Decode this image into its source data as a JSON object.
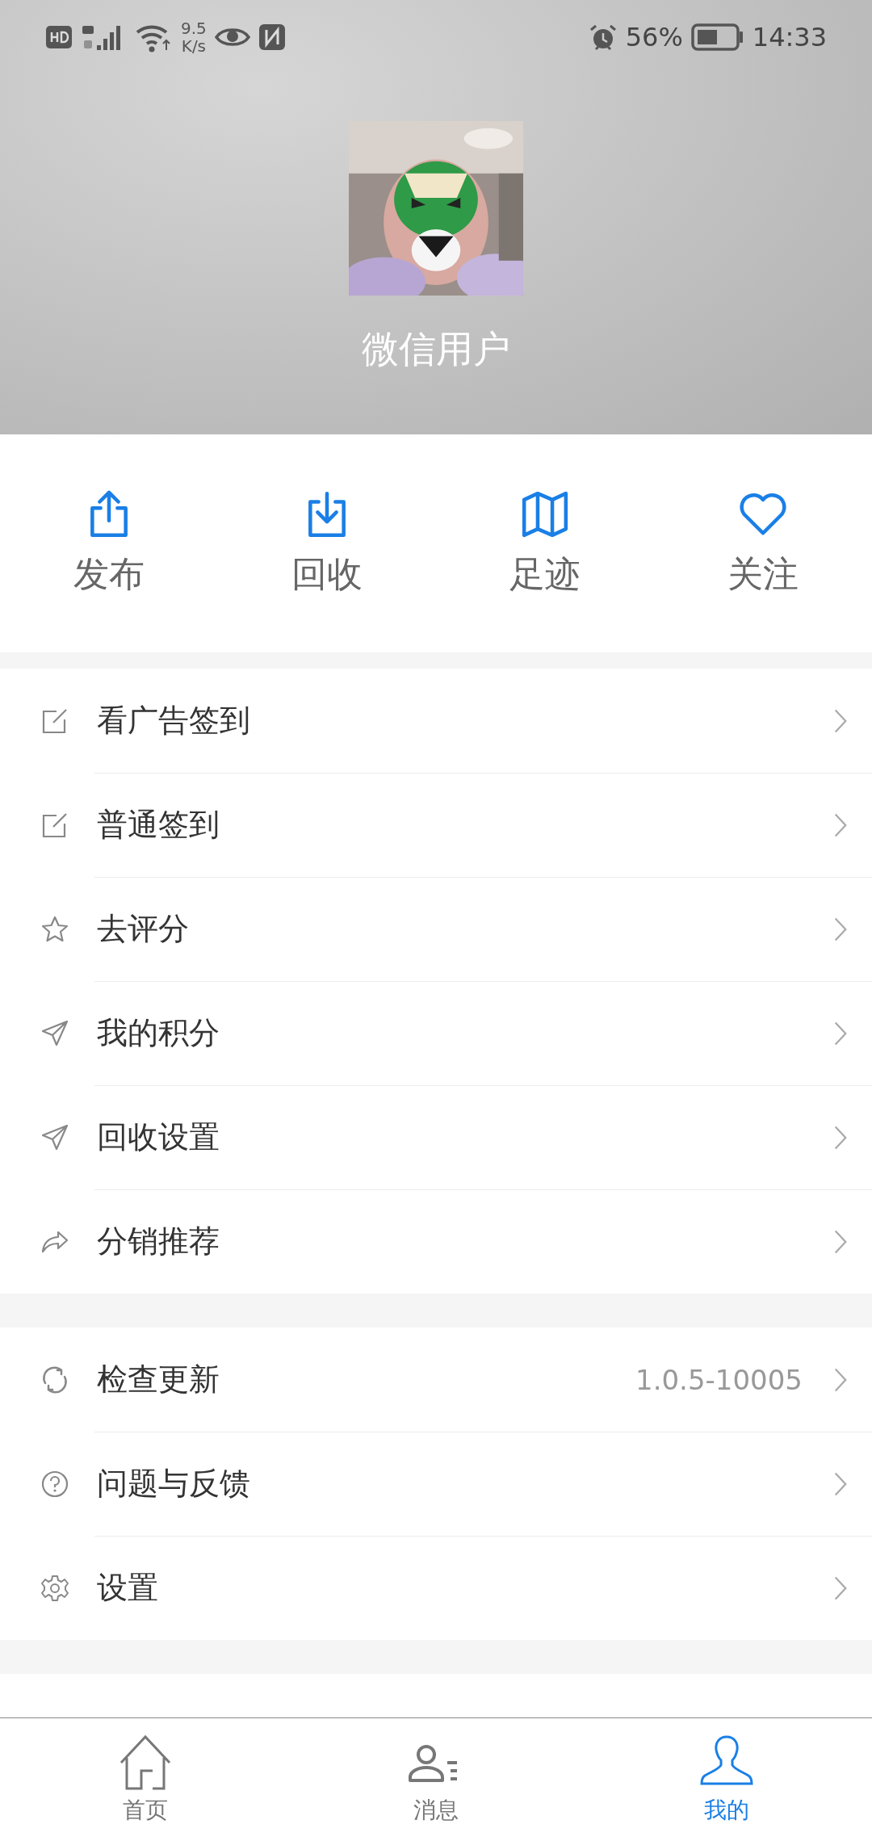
{
  "status_bar": {
    "speed_value": "9.5",
    "speed_unit": "K/s",
    "battery": "56%",
    "time": "14:33"
  },
  "profile": {
    "name": "微信用户"
  },
  "actions": [
    {
      "label": "发布"
    },
    {
      "label": "回收"
    },
    {
      "label": "足迹"
    },
    {
      "label": "关注"
    }
  ],
  "menu_groups": [
    {
      "items": [
        {
          "label": "看广告签到"
        },
        {
          "label": "普通签到"
        },
        {
          "label": "去评分"
        },
        {
          "label": "我的积分"
        },
        {
          "label": "回收设置"
        },
        {
          "label": "分销推荐"
        }
      ]
    },
    {
      "items": [
        {
          "label": "检查更新",
          "value": "1.0.5-10005"
        },
        {
          "label": "问题与反馈"
        },
        {
          "label": "设置"
        }
      ]
    }
  ],
  "tab_bar": [
    {
      "label": "首页",
      "selected": false
    },
    {
      "label": "消息",
      "selected": false
    },
    {
      "label": "我的",
      "selected": true
    }
  ]
}
